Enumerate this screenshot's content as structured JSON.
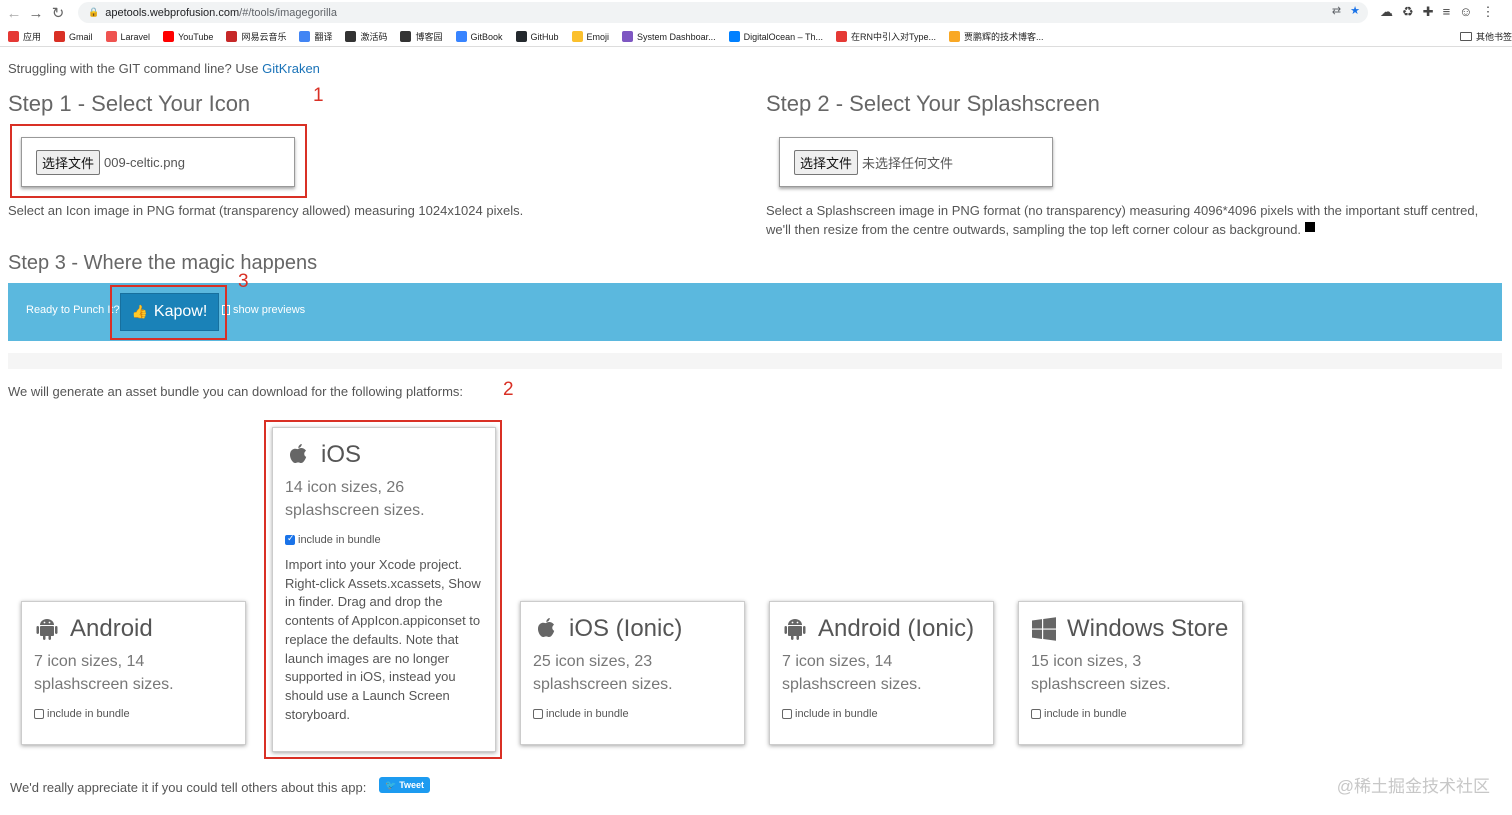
{
  "browser": {
    "url_host": "apetools.webprofusion.com",
    "url_path": "/#/tools/imagegorilla",
    "bookmarks": [
      {
        "label": "应用",
        "color": "#e53935"
      },
      {
        "label": "Gmail",
        "color": "#d93025"
      },
      {
        "label": "Laravel",
        "color": "#ef5350"
      },
      {
        "label": "YouTube",
        "color": "#ff0000"
      },
      {
        "label": "网易云音乐",
        "color": "#c62828"
      },
      {
        "label": "翻译",
        "color": "#4285f4"
      },
      {
        "label": "激活码",
        "color": "#333333"
      },
      {
        "label": "博客园",
        "color": "#333333"
      },
      {
        "label": "GitBook",
        "color": "#3884ff"
      },
      {
        "label": "GitHub",
        "color": "#24292e"
      },
      {
        "label": "Emoji",
        "color": "#fbc02d"
      },
      {
        "label": "System Dashboar...",
        "color": "#7e57c2"
      },
      {
        "label": "DigitalOcean – Th...",
        "color": "#0080ff"
      },
      {
        "label": "在RN中引入对Type...",
        "color": "#e53935"
      },
      {
        "label": "贾鹏辉的技术博客...",
        "color": "#f9a825"
      }
    ],
    "other_bookmarks": "其他书签"
  },
  "promo": {
    "text": "Struggling with the GIT command line? Use ",
    "link": "GitKraken"
  },
  "step1": {
    "title": "Step 1 - Select Your Icon",
    "button": "选择文件",
    "file": "009-celtic.png",
    "help": "Select an Icon image in PNG format (transparency allowed) measuring 1024x1024 pixels."
  },
  "step2": {
    "title": "Step 2 - Select Your Splashscreen",
    "button": "选择文件",
    "file": "未选择任何文件",
    "help_line1": "Select a Splashscreen image in PNG format (no transparency) measuring 4096*4096 pixels with the important stuff centred,",
    "help_line2": "we'll then resize from the centre outwards, sampling the top left corner colour as background."
  },
  "step3": {
    "title": "Step 3 - Where the magic happens",
    "ready": "Ready to Punch It?",
    "kapow": "Kapow!",
    "show_previews": "show previews"
  },
  "annotations": {
    "n1": "1",
    "n2": "2",
    "n3": "3"
  },
  "platforms_intro": "We will generate an asset bundle you can download for the following platforms:",
  "platforms": [
    {
      "name": "Android",
      "sizes": "7 icon sizes, 14 splashscreen sizes.",
      "include": "include in bundle",
      "checked": false
    },
    {
      "name": "iOS",
      "sizes": "14 icon sizes, 26 splashscreen sizes.",
      "include": "include in bundle",
      "checked": true,
      "description": "Import into your Xcode project. Right-click Assets.xcassets, Show in finder. Drag and drop the contents of AppIcon.appiconset to replace the defaults. Note that launch images are no longer supported in iOS, instead you should use a Launch Screen storyboard."
    },
    {
      "name": "iOS (Ionic)",
      "sizes": "25 icon sizes, 23 splashscreen sizes.",
      "include": "include in bundle",
      "checked": false
    },
    {
      "name": "Android (Ionic)",
      "sizes": "7 icon sizes, 14 splashscreen sizes.",
      "include": "include in bundle",
      "checked": false
    },
    {
      "name": "Windows Store",
      "sizes": "15 icon sizes, 3 splashscreen sizes.",
      "include": "include in bundle",
      "checked": false
    }
  ],
  "share": {
    "text": "We'd really appreciate it if you could tell others about this app:",
    "tweet": "Tweet"
  },
  "watermark": "@稀土掘金技术社区"
}
